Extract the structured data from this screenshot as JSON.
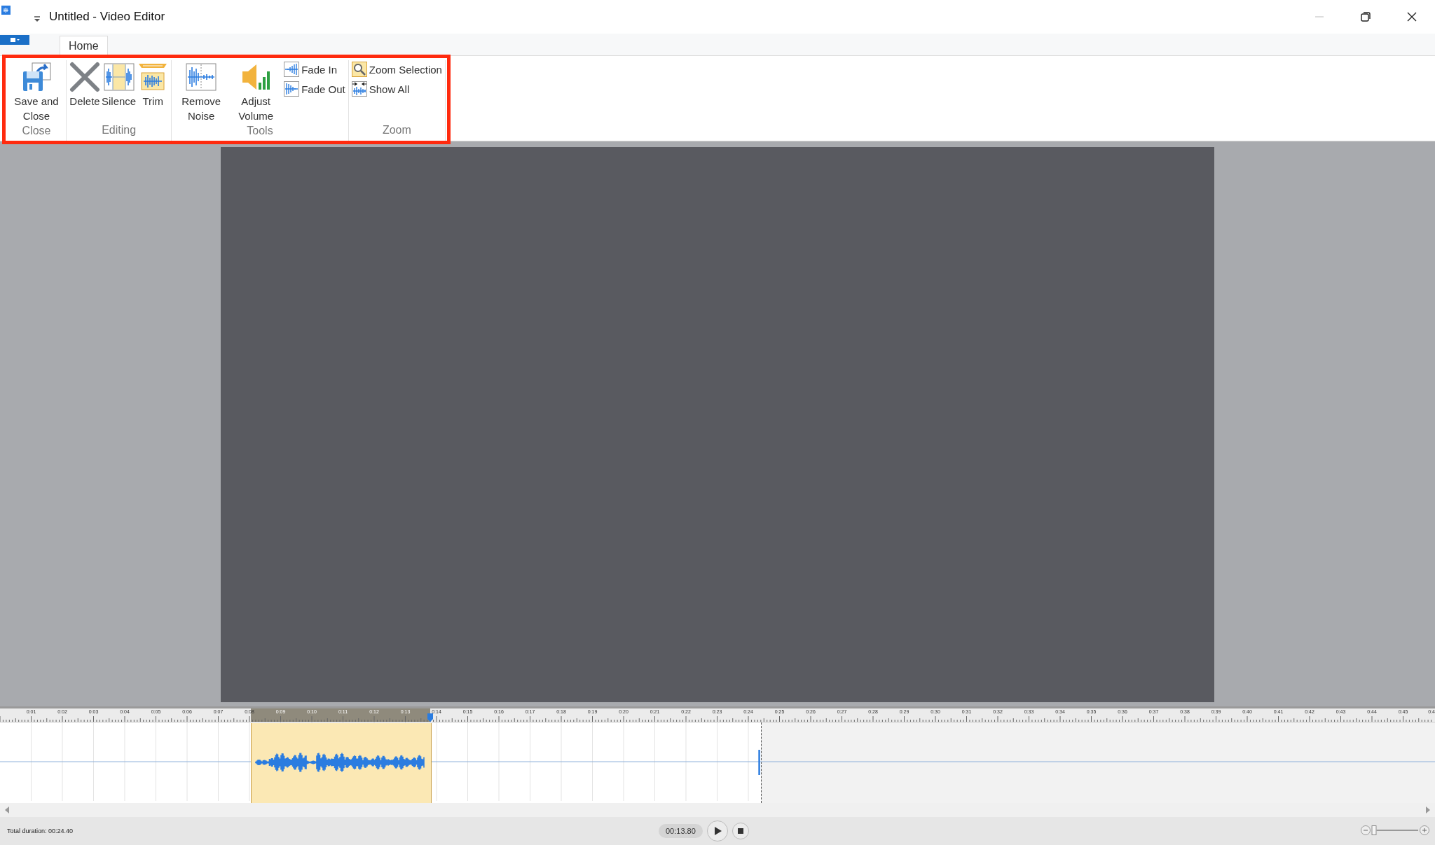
{
  "window": {
    "title": "Untitled - Video Editor"
  },
  "tabs": [
    {
      "label": "Home",
      "selected": true
    }
  ],
  "ribbon": {
    "groups": [
      {
        "label": "Close",
        "items": [
          {
            "kind": "large",
            "label": "Save and Close"
          }
        ]
      },
      {
        "label": "Editing",
        "items": [
          {
            "kind": "large",
            "label": "Delete"
          },
          {
            "kind": "large",
            "label": "Silence"
          },
          {
            "kind": "large",
            "label": "Trim"
          }
        ]
      },
      {
        "label": "Tools",
        "items": [
          {
            "kind": "large",
            "label": "Remove Noise"
          },
          {
            "kind": "large",
            "label": "Adjust Volume"
          },
          {
            "kind": "small",
            "label": "Fade In"
          },
          {
            "kind": "small",
            "label": "Fade Out"
          }
        ]
      },
      {
        "label": "Zoom",
        "items": [
          {
            "kind": "small",
            "label": "Zoom Selection"
          },
          {
            "kind": "small",
            "label": "Show All"
          }
        ]
      }
    ]
  },
  "timeline": {
    "ticks": [
      "0:01",
      "0:02",
      "0:03",
      "0:04",
      "0:05",
      "0:06",
      "0:07",
      "0:08",
      "0:09",
      "0:10",
      "0:11",
      "0:12",
      "0:13",
      "0:14",
      "0:15",
      "0:16",
      "0:17",
      "0:18",
      "0:19",
      "0:20",
      "0:21",
      "0:22",
      "0:23",
      "0:24",
      "0:25",
      "0:26",
      "0:27",
      "0:28",
      "0:29",
      "0:30",
      "0:31",
      "0:32",
      "0:33",
      "0:34",
      "0:35",
      "0:36",
      "0:37",
      "0:38",
      "0:39",
      "0:40",
      "0:41",
      "0:42",
      "0:43",
      "0:44",
      "0:45",
      "0:4"
    ]
  },
  "status_bar": {
    "total_duration": "Total duration: 00:24.40",
    "position": "00:13.80",
    "zoom": {
      "level": 0.05
    }
  }
}
